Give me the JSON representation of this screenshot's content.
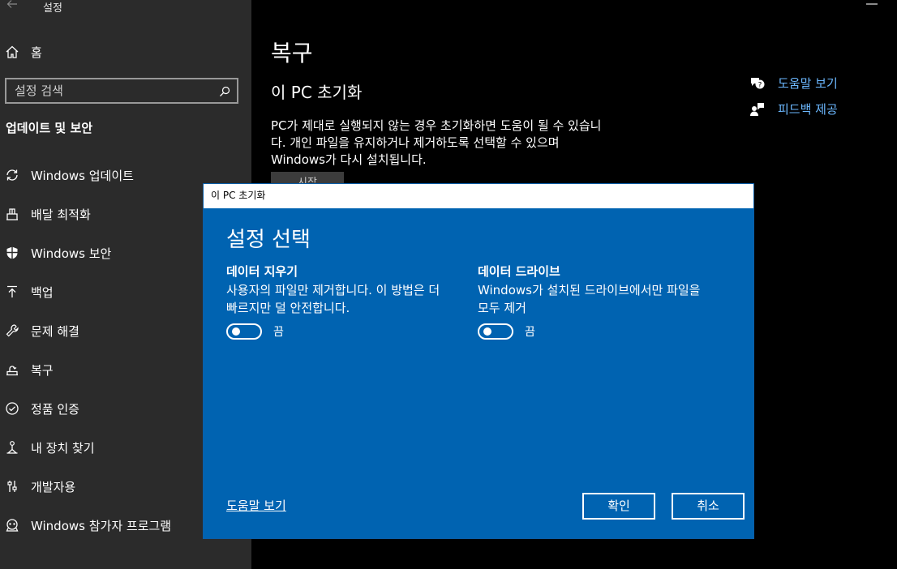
{
  "window": {
    "title": "설정"
  },
  "sidebar": {
    "home_label": "홈",
    "search_placeholder": "설정 검색",
    "section_title": "업데이트 및 보안",
    "items": [
      {
        "label": "Windows 업데이트",
        "icon": "refresh-icon"
      },
      {
        "label": "배달 최적화",
        "icon": "delivery-optimization-icon"
      },
      {
        "label": "Windows 보안",
        "icon": "shield-icon"
      },
      {
        "label": "백업",
        "icon": "backup-arrow-icon"
      },
      {
        "label": "문제 해결",
        "icon": "wrench-icon"
      },
      {
        "label": "복구",
        "icon": "recovery-icon"
      },
      {
        "label": "정품 인증",
        "icon": "check-circle-icon"
      },
      {
        "label": "내 장치 찾기",
        "icon": "find-device-icon"
      },
      {
        "label": "개발자용",
        "icon": "developer-sliders-icon"
      },
      {
        "label": "Windows 참가자 프로그램",
        "icon": "insider-icon"
      }
    ]
  },
  "main": {
    "title": "복구",
    "subtitle": "이 PC 초기화",
    "description_lines": [
      "PC가 제대로 실행되지 않는 경우 초기화하면 도움이 될 수 있습니",
      "다. 개인 파일을 유지하거나 제거하도록 선택할 수 있으며",
      "Windows가 다시 설치됩니다."
    ],
    "start_button": "시작",
    "related": [
      {
        "label": "도움말 보기",
        "icon": "help-chat-icon"
      },
      {
        "label": "피드백 제공",
        "icon": "feedback-person-icon"
      }
    ]
  },
  "dialog": {
    "titlebar": "이 PC 초기화",
    "heading": "설정 선택",
    "options": [
      {
        "title": "데이터 지우기",
        "description_lines": [
          "사용자의 파일만 제거합니다. 이 방법은 더",
          "빠르지만 덜 안전합니다."
        ],
        "toggle_state": "끔"
      },
      {
        "title": "데이터 드라이브",
        "description_lines": [
          "Windows가 설치된 드라이브에서만 파일을",
          "모두 제거"
        ],
        "toggle_state": "끔"
      }
    ],
    "help_link": "도움말 보기",
    "confirm_button": "확인",
    "cancel_button": "취소"
  },
  "colors": {
    "sidebar_bg": "#2b2b2b",
    "main_bg": "#000000",
    "dialog_bg": "#0063b1",
    "link": "#6cb8ff"
  }
}
